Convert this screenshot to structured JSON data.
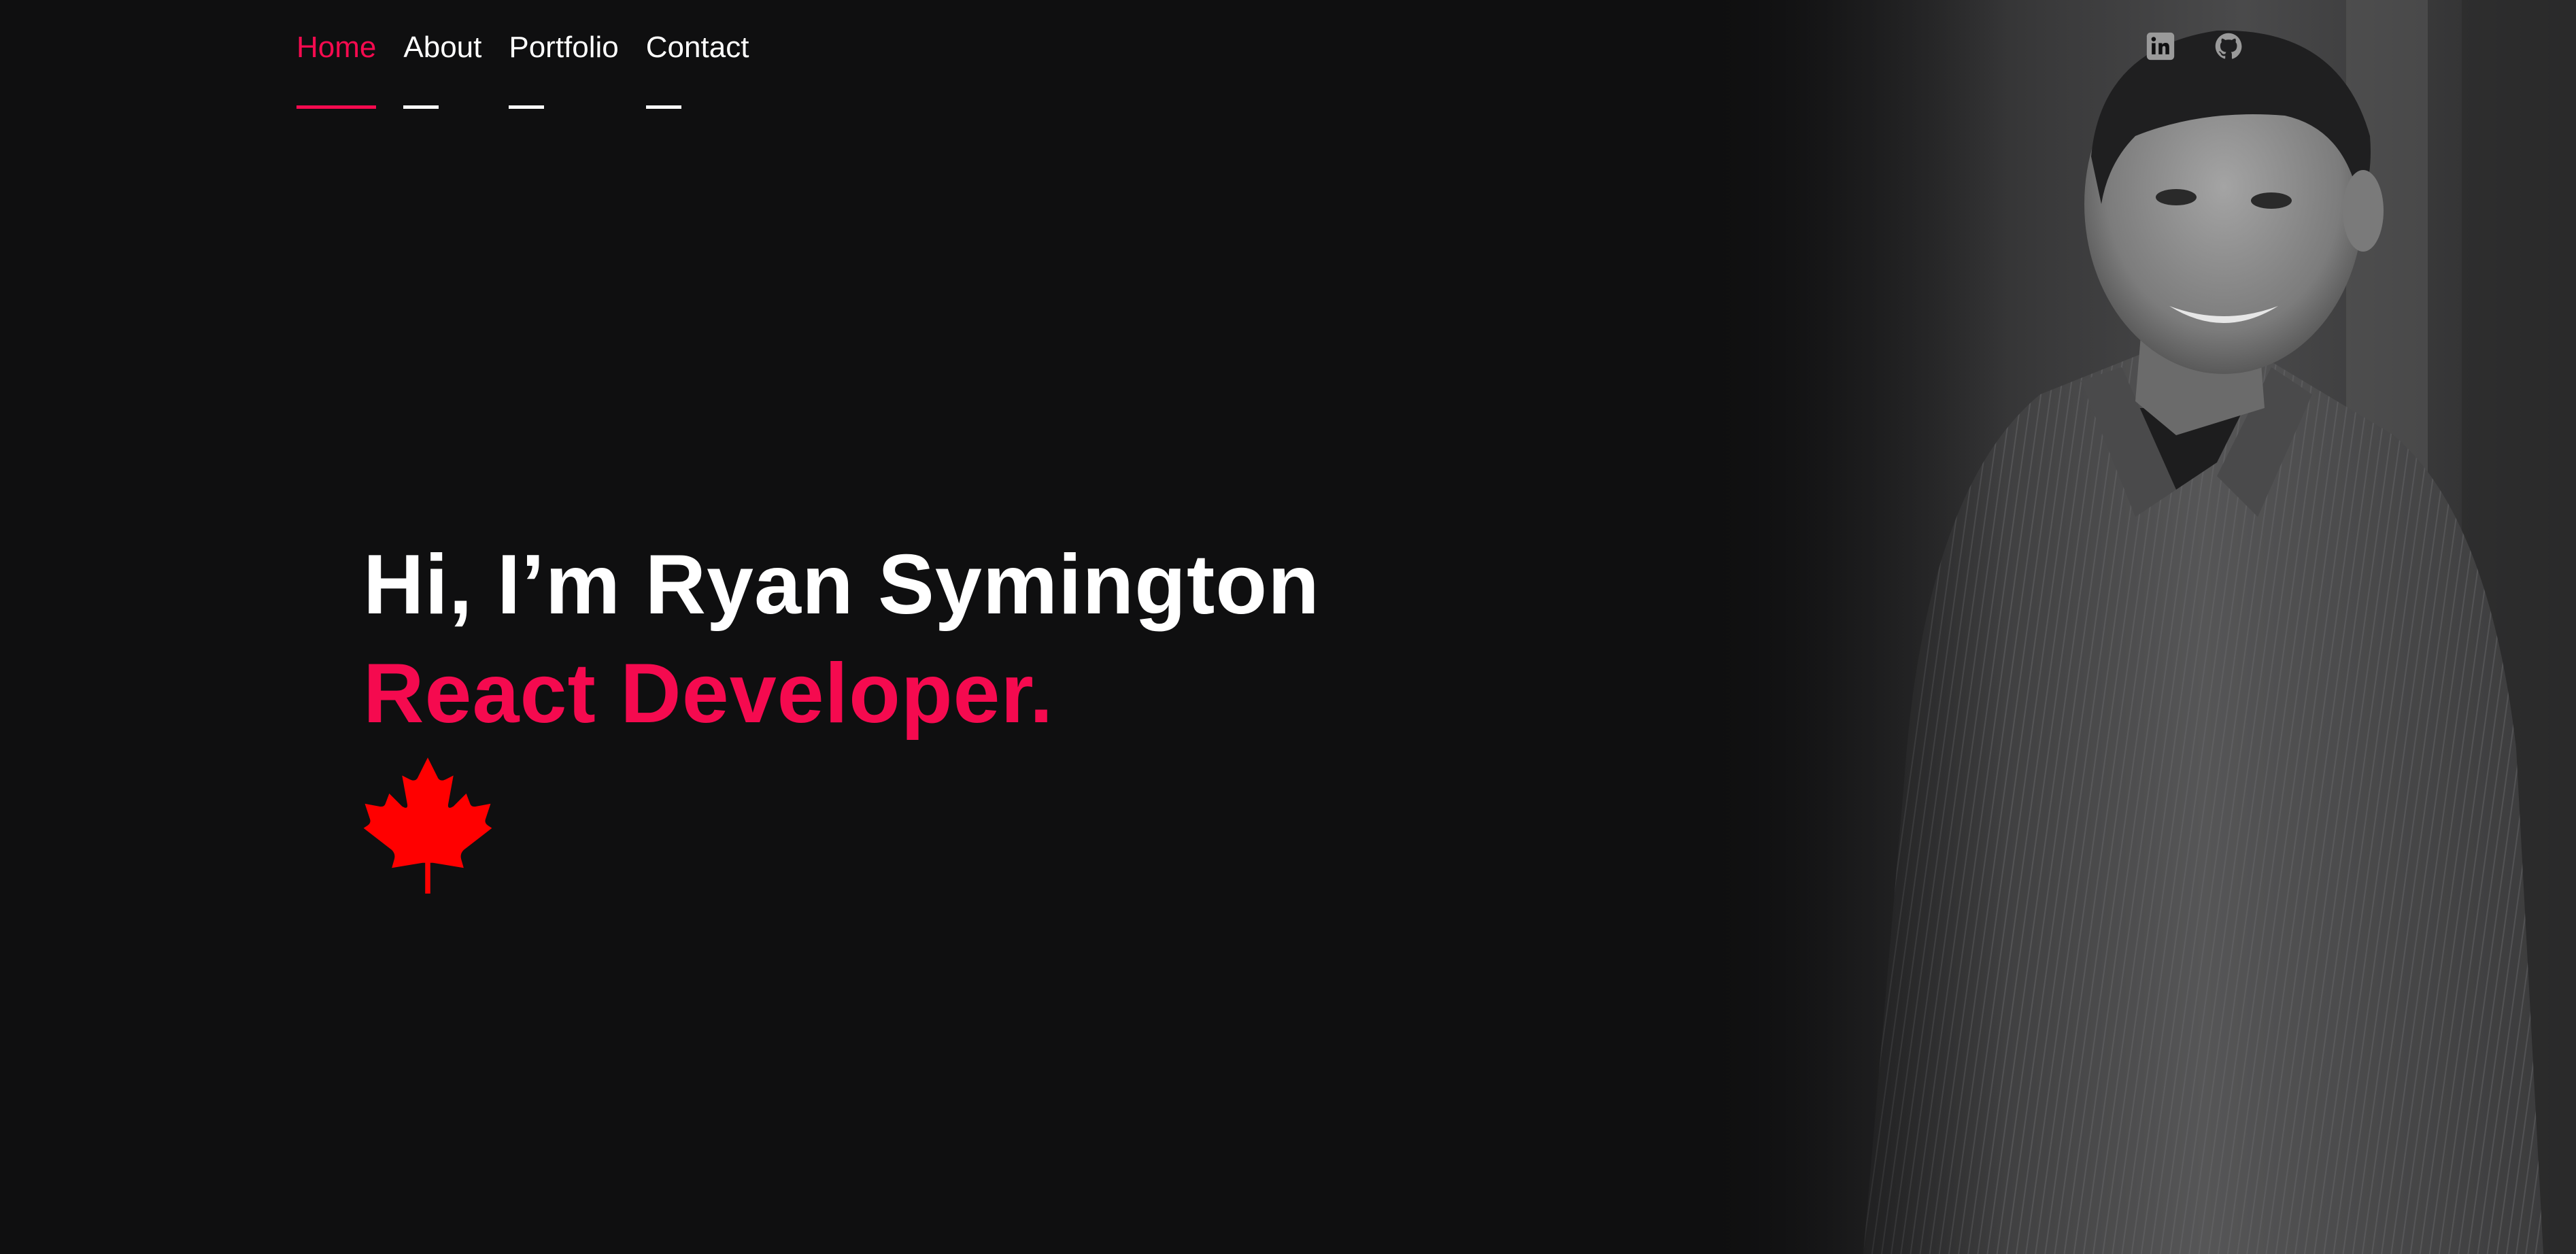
{
  "nav": {
    "items": [
      {
        "label": "Home",
        "active": true
      },
      {
        "label": "About",
        "active": false
      },
      {
        "label": "Portfolio",
        "active": false
      },
      {
        "label": "Contact",
        "active": false
      }
    ]
  },
  "social": {
    "items": [
      {
        "icon": "linkedin-icon"
      },
      {
        "icon": "github-icon"
      }
    ]
  },
  "hero": {
    "greeting": "Hi, I’m Ryan Symington",
    "role": "React Developer.",
    "flag_icon": "maple-leaf-icon"
  },
  "colors": {
    "background": "#0f0f10",
    "accent": "#f50a4f",
    "text": "#ffffff",
    "maple_leaf": "#ff0000",
    "icon": "#9a9a9a"
  }
}
